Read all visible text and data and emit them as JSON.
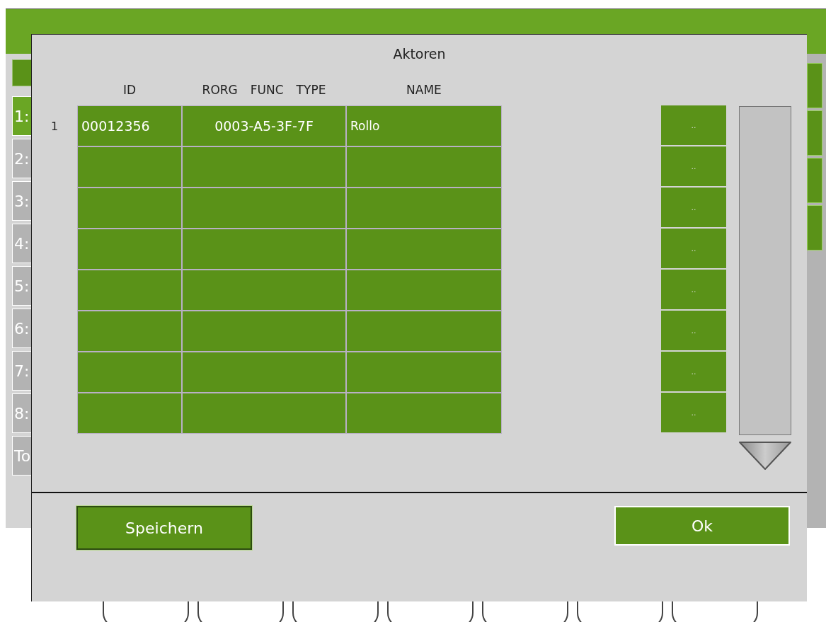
{
  "background": {
    "tabs": [
      {
        "label": "1:",
        "selected": true
      },
      {
        "label": "2:",
        "selected": false
      },
      {
        "label": "3:",
        "selected": false
      },
      {
        "label": "4:",
        "selected": false
      },
      {
        "label": "5:",
        "selected": false
      },
      {
        "label": "6:",
        "selected": false
      },
      {
        "label": "7:",
        "selected": false
      },
      {
        "label": "8:",
        "selected": false
      },
      {
        "label": "To",
        "selected": false
      }
    ]
  },
  "dialog": {
    "title": "Aktoren",
    "columns": [
      "ID",
      "RORG",
      "FUNC",
      "TYPE",
      "NAME"
    ],
    "rows": [
      {
        "number": "1",
        "id": "00012356",
        "code": "0003-A5-3F-7F",
        "name": "Rollo",
        "action": ".."
      },
      {
        "action": ".."
      },
      {
        "action": ".."
      },
      {
        "action": ".."
      },
      {
        "action": ".."
      },
      {
        "action": ".."
      },
      {
        "action": ".."
      },
      {
        "action": ".."
      }
    ],
    "buttons": [
      "Speichern",
      "Ok"
    ]
  }
}
